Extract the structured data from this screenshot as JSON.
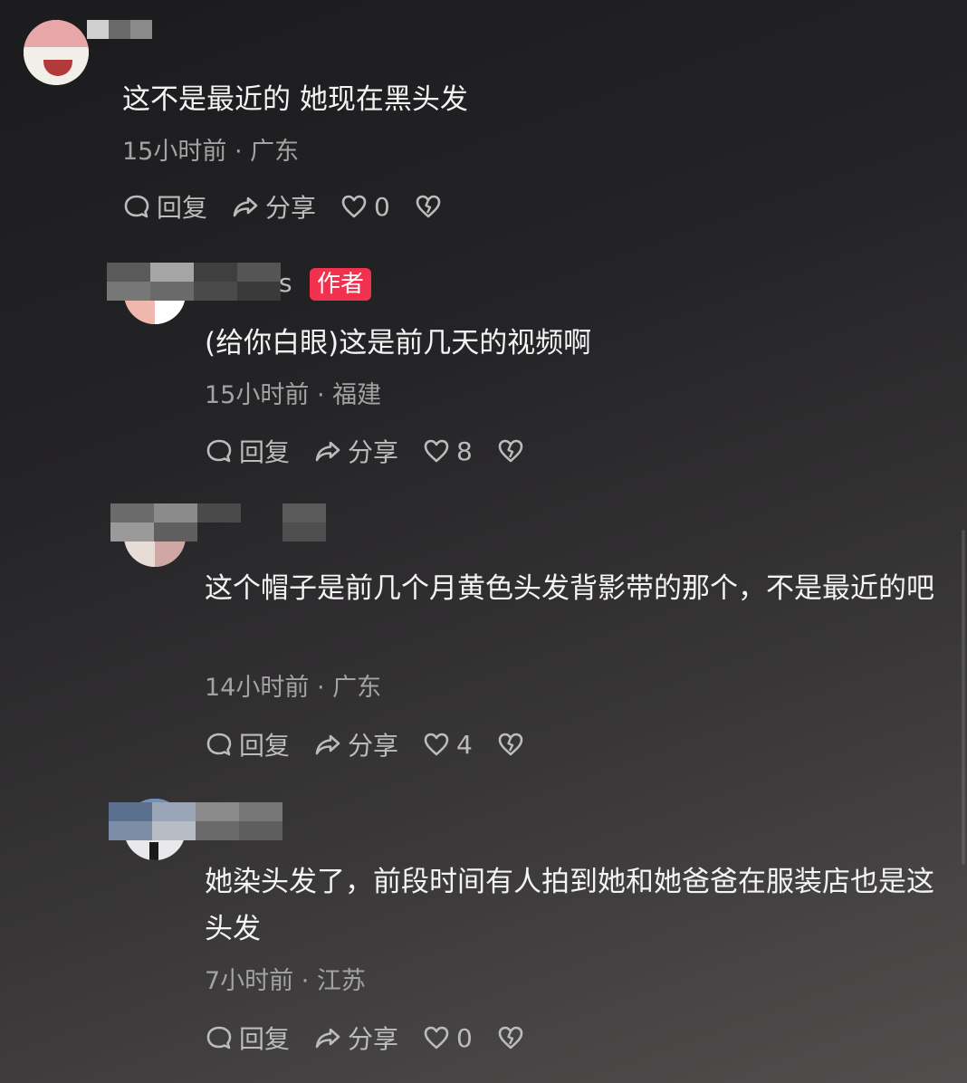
{
  "comments": [
    {
      "text": "这不是最近的 她现在黑头发",
      "meta": "15小时前 · 广东",
      "reply_label": "回复",
      "share_label": "分享",
      "likes": "0"
    },
    {
      "username_suffix": "s",
      "badge": "作者",
      "text": "(给你白眼)这是前几天的视频啊",
      "meta": "15小时前 · 福建",
      "reply_label": "回复",
      "share_label": "分享",
      "likes": "8"
    },
    {
      "text": "这个帽子是前几个月黄色头发背影带的那个，不是最近的吧",
      "meta": "14小时前 · 广东",
      "reply_label": "回复",
      "share_label": "分享",
      "likes": "4"
    },
    {
      "text": "她染头发了，前段时间有人拍到她和她爸爸在服装店也是这头发",
      "meta": "7小时前 · 江苏",
      "reply_label": "回复",
      "share_label": "分享",
      "likes": "0"
    }
  ],
  "icons": {
    "reply": "comment-bubble-icon",
    "share": "share-arrow-icon",
    "like": "heart-icon",
    "dislike": "broken-heart-icon"
  },
  "colors": {
    "author_badge": "#f2314f",
    "meta_text": "#a3a3a3",
    "action_text": "#bcbcbc"
  }
}
